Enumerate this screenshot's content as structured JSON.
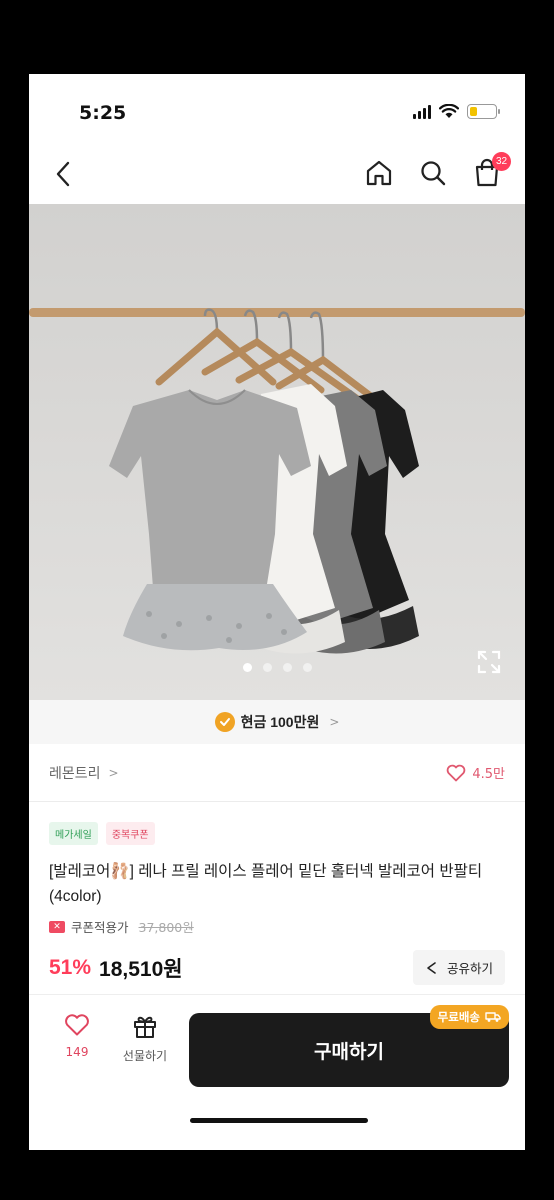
{
  "status_bar": {
    "time": "5:25"
  },
  "nav": {
    "cart_count": "32",
    "icons": [
      "back-icon",
      "home-icon",
      "search-icon",
      "cart-icon"
    ]
  },
  "hero": {
    "slide_count": 4,
    "active_slide": 1
  },
  "promo": {
    "text": "현금 100만원",
    "icon": "check-badge-icon",
    "accent": "#f0a324"
  },
  "store": {
    "name": "레몬트리",
    "likes": "4.5만"
  },
  "product": {
    "tags": [
      "메가세일",
      "중복쿠폰"
    ],
    "title": "[발레코어🩰] 레나 프릴 레이스 플레어 밑단 홀터넥 발레코어 반팔티 (4color)",
    "coupon_label": "쿠폰적용가",
    "original_price": "37,800원",
    "discount": "51%",
    "price": "18,510원",
    "share_label": "공유하기"
  },
  "bottom_bar": {
    "like_count": "149",
    "gift_label": "선물하기",
    "buy_label": "구매하기",
    "free_shipping_label": "무료배송"
  },
  "colors": {
    "accent_red": "#ff3d5a",
    "buy_button": "#1b1b1b",
    "free_ship": "#f3a623"
  }
}
